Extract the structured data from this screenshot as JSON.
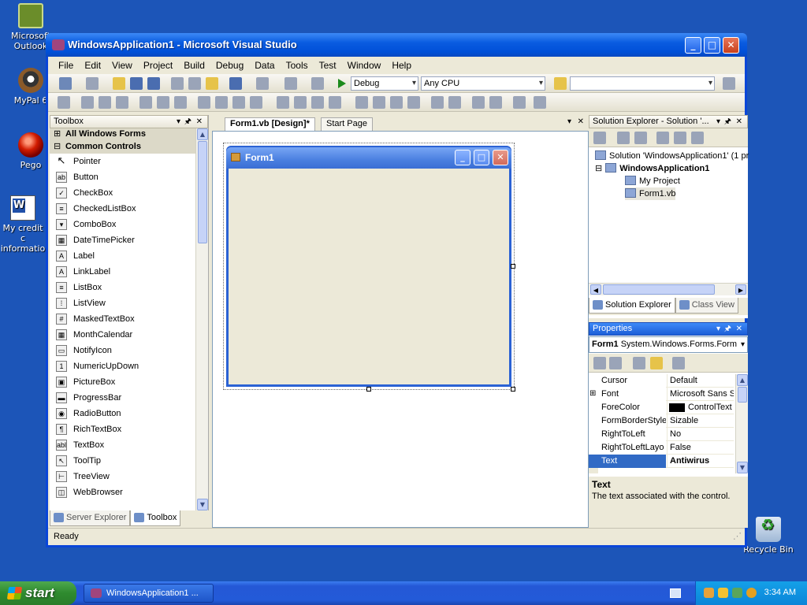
{
  "desktop": {
    "icons": [
      {
        "label": "Microsoft Outlook",
        "icon": "outlook-icon"
      },
      {
        "label": "MyPal 6",
        "icon": "mypal-icon"
      },
      {
        "label": "Pego",
        "icon": "pego-icon"
      },
      {
        "label": "My credit c informatio",
        "icon": "word-document-icon"
      },
      {
        "label": "Recycle Bin",
        "icon": "recycle-bin-icon"
      }
    ]
  },
  "window": {
    "title": "WindowsApplication1 - Microsoft Visual Studio",
    "controls": {
      "minimize": "_",
      "maximize": "□",
      "close": "✕"
    }
  },
  "menu": [
    "File",
    "Edit",
    "View",
    "Project",
    "Build",
    "Debug",
    "Data",
    "Tools",
    "Test",
    "Window",
    "Help"
  ],
  "toolbar": {
    "configuration": "Debug",
    "platform": "Any CPU",
    "find_combo": ""
  },
  "toolbox": {
    "header": "Toolbox",
    "categories": [
      "All Windows Forms",
      "Common Controls"
    ],
    "items": [
      {
        "label": "Pointer",
        "glyph": "↖"
      },
      {
        "label": "Button",
        "glyph": "ab"
      },
      {
        "label": "CheckBox",
        "glyph": "✓"
      },
      {
        "label": "CheckedListBox",
        "glyph": "≡"
      },
      {
        "label": "ComboBox",
        "glyph": "▾"
      },
      {
        "label": "DateTimePicker",
        "glyph": "▦"
      },
      {
        "label": "Label",
        "glyph": "A"
      },
      {
        "label": "LinkLabel",
        "glyph": "A"
      },
      {
        "label": "ListBox",
        "glyph": "≡"
      },
      {
        "label": "ListView",
        "glyph": "⁞"
      },
      {
        "label": "MaskedTextBox",
        "glyph": "#"
      },
      {
        "label": "MonthCalendar",
        "glyph": "▦"
      },
      {
        "label": "NotifyIcon",
        "glyph": "▭"
      },
      {
        "label": "NumericUpDown",
        "glyph": "1"
      },
      {
        "label": "PictureBox",
        "glyph": "▣"
      },
      {
        "label": "ProgressBar",
        "glyph": "▬"
      },
      {
        "label": "RadioButton",
        "glyph": "◉"
      },
      {
        "label": "RichTextBox",
        "glyph": "¶"
      },
      {
        "label": "TextBox",
        "glyph": "abl"
      },
      {
        "label": "ToolTip",
        "glyph": "↖"
      },
      {
        "label": "TreeView",
        "glyph": "⊢"
      },
      {
        "label": "WebBrowser",
        "glyph": "◫"
      }
    ],
    "bottom_tabs": [
      "Server Explorer",
      "Toolbox"
    ]
  },
  "documents": {
    "tabs": [
      "Form1.vb [Design]*",
      "Start Page"
    ],
    "form_title": "Form1"
  },
  "solution_explorer": {
    "header": "Solution Explorer - Solution '...",
    "tree": [
      {
        "label": "Solution 'WindowsApplication1' (1 pr",
        "level": 0
      },
      {
        "label": "WindowsApplication1",
        "level": 1
      },
      {
        "label": "My Project",
        "level": 2
      },
      {
        "label": "Form1.vb",
        "level": 2
      }
    ],
    "bottom_tabs": [
      "Solution Explorer",
      "Class View"
    ]
  },
  "properties": {
    "header": "Properties",
    "object": "Form1",
    "object_type": "System.Windows.Forms.Form",
    "rows": [
      {
        "name": "Cursor",
        "value": "Default",
        "expandable": false
      },
      {
        "name": "Font",
        "value": "Microsoft Sans Se",
        "expandable": true
      },
      {
        "name": "ForeColor",
        "value": "ControlText",
        "expandable": false
      },
      {
        "name": "FormBorderStyle",
        "value": "Sizable",
        "expandable": false
      },
      {
        "name": "RightToLeft",
        "value": "No",
        "expandable": false
      },
      {
        "name": "RightToLeftLayo",
        "value": "False",
        "expandable": false
      },
      {
        "name": "Text",
        "value": "Antiwirus",
        "expandable": false
      }
    ],
    "description_title": "Text",
    "description_body": "The text associated with the control."
  },
  "status": {
    "text": "Ready"
  },
  "taskbar": {
    "start_label": "start",
    "task_label": "WindowsApplication1 ...",
    "clock": "3:34 AM"
  },
  "colors": {
    "desktop": "#1c55b8",
    "title_bar": "#0a5ce0",
    "selection": "#316ac5",
    "start_button": "#2e8a2e"
  }
}
